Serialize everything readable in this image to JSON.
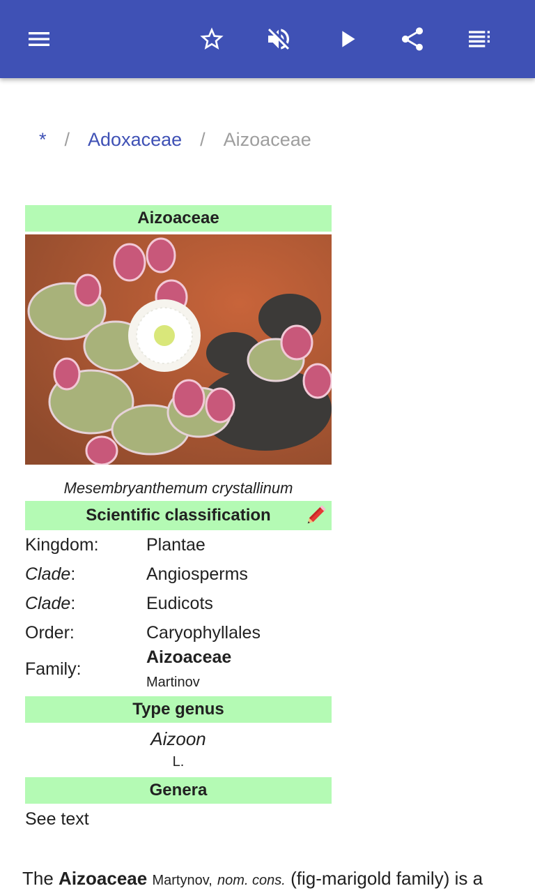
{
  "toolbar": {
    "icons": [
      "menu-icon",
      "star-outline-icon",
      "volume-off-icon",
      "play-icon",
      "share-icon",
      "playlist-icon"
    ],
    "accent_color": "#3f51b5"
  },
  "breadcrumb": {
    "root": "*",
    "separator": "/",
    "parent": "Adoxaceae",
    "current": "Aizoaceae"
  },
  "infobox": {
    "title": "Aizoaceae",
    "image_caption": "Mesembryanthemum crystallinum",
    "classification_header": "Scientific classification",
    "header_color": "#b4fab4",
    "rows": [
      {
        "label": "Kingdom",
        "value": "Plantae"
      },
      {
        "label": "Clade",
        "value": "Angiosperms"
      },
      {
        "label": "Clade",
        "value": "Eudicots"
      },
      {
        "label": "Order",
        "value": "Caryophyllales"
      }
    ],
    "colon": ":",
    "family": {
      "label": "Family",
      "name": "Aizoaceae",
      "authority": "Martinov"
    },
    "type_genus_header": "Type genus",
    "type_genus": {
      "name": "Aizoon",
      "authority": "L."
    },
    "genera_header": "Genera",
    "genera_value": "See text"
  },
  "article": {
    "lead_prefix": "The",
    "lead_bold": "Aizoaceae",
    "lead_author": "Martynov,",
    "lead_status": "nom. cons.",
    "lead_rest": "(fig-marigold family) is a"
  }
}
